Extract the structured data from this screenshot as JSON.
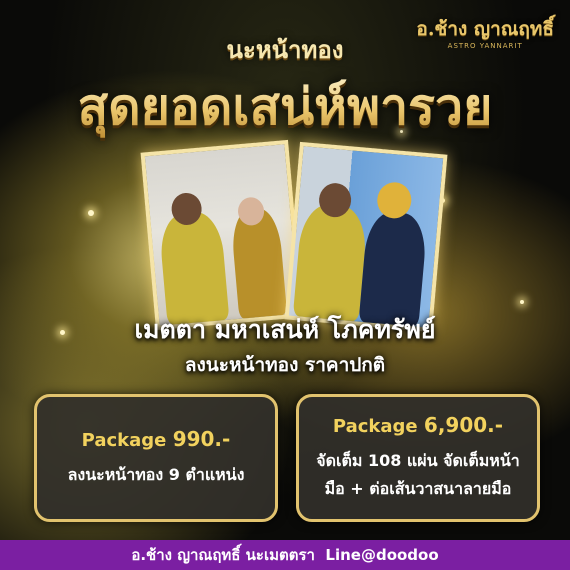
{
  "logo": {
    "name": "อ.ช้าง ญาณฤทธิ์",
    "tagline": "ASTRO YANNARIT"
  },
  "kicker": "นะหน้าทอง",
  "headline": "สุดยอดเสน่ห์พารวย",
  "subtitle_main": "เมตตา มหาเสน่ห์ โภคทรัพย์",
  "subtitle_sub": "ลงนะหน้าทอง ราคาปกติ",
  "packages": [
    {
      "label": "Package",
      "price": "990.-",
      "lines": [
        "ลงนะหน้าทอง 9 ตำแหน่ง"
      ]
    },
    {
      "label": "Package",
      "price": "6,900.-",
      "lines": [
        "จัดเต็ม 108 แผ่น จัดเต็มหน้า",
        "มือ + ต่อเส้นวาสนาลายมือ"
      ]
    }
  ],
  "footer": {
    "text": "อ.ช้าง ญาณฤทธิ์ นะเมตตรา  Line@doodoo"
  },
  "colors": {
    "gold": "#e2c36e",
    "package_text": "#f2d25e",
    "footer_bg": "#7b1fa2",
    "box_bg": "#322f2a"
  }
}
